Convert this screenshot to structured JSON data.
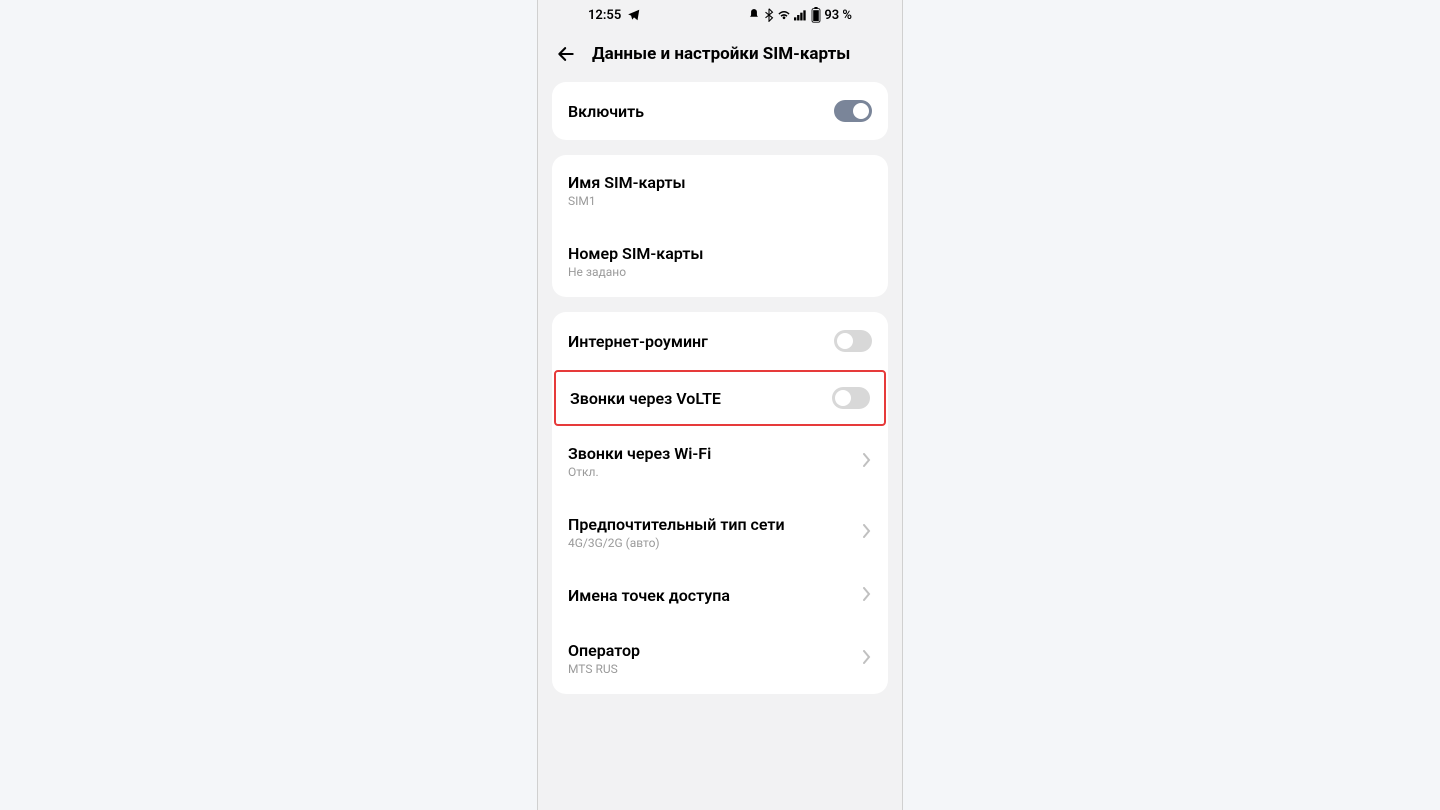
{
  "status": {
    "time": "12:55",
    "battery": "93 %"
  },
  "header": {
    "title": "Данные и настройки SIM-карты"
  },
  "card1": {
    "enable": {
      "label": "Включить",
      "on": true
    }
  },
  "card2": {
    "sim_name": {
      "label": "Имя SIM-карты",
      "value": "SIM1"
    },
    "sim_number": {
      "label": "Номер SIM-карты",
      "value": "Не задано"
    }
  },
  "card3": {
    "roaming": {
      "label": "Интернет-роуминг",
      "on": false
    },
    "volte": {
      "label": "Звонки через VoLTE",
      "on": false
    },
    "wifi_calls": {
      "label": "Звонки через Wi-Fi",
      "value": "Откл."
    },
    "net_type": {
      "label": "Предпочтительный тип сети",
      "value": "4G/3G/2G (авто)"
    },
    "apn": {
      "label": "Имена точек доступа"
    },
    "operator": {
      "label": "Оператор",
      "value": "MTS RUS"
    }
  }
}
